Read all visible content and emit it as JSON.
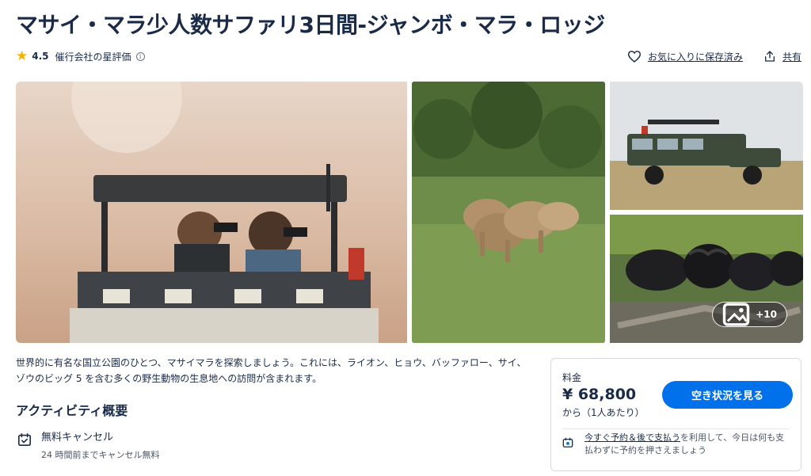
{
  "title": "マサイ・マラ少人数サファリ3日間-ジャンボ・マラ・ロッジ",
  "rating": {
    "star_icon": "star-icon",
    "score": "4.5",
    "label": "催行会社の星評価",
    "info_icon": "info-icon"
  },
  "actions": {
    "save_label": "お気に入りに保存済み",
    "save_icon": "heart-icon",
    "share_label": "共有",
    "share_icon": "share-icon"
  },
  "gallery": {
    "photos": [
      "safari-vehicle-binoculars",
      "lions",
      "safari-land-cruiser",
      "buffalo-herd"
    ],
    "more_label": "+10",
    "more_icon": "image-icon"
  },
  "description": "世界的に有名な国立公園のひとつ、マサイマラを探索しましょう。これには、ライオン、ヒョウ、バッファロー、サイ、ゾウのビッグ 5 を含む多くの野生動物の生息地への訪問が含まれます。",
  "overview": {
    "title": "アクティビティ概要",
    "items": [
      {
        "icon": "calendar-check-icon",
        "title": "無料キャンセル",
        "subtitle": "24 時間前までキャンセル無料"
      }
    ]
  },
  "price_card": {
    "label": "料金",
    "price": "¥ 68,800",
    "unit": "から（1人あたり）",
    "button_label": "空き状況を見る",
    "pay_later": {
      "icon": "calendar-money-icon",
      "link_text": "今すぐ予約＆後で支払う",
      "text": "を利用して、今日は何も支払わずに予約を押さえましょう"
    }
  },
  "colors": {
    "primary": "#0071eb",
    "text": "#1a2b49",
    "star": "#f5b301"
  }
}
